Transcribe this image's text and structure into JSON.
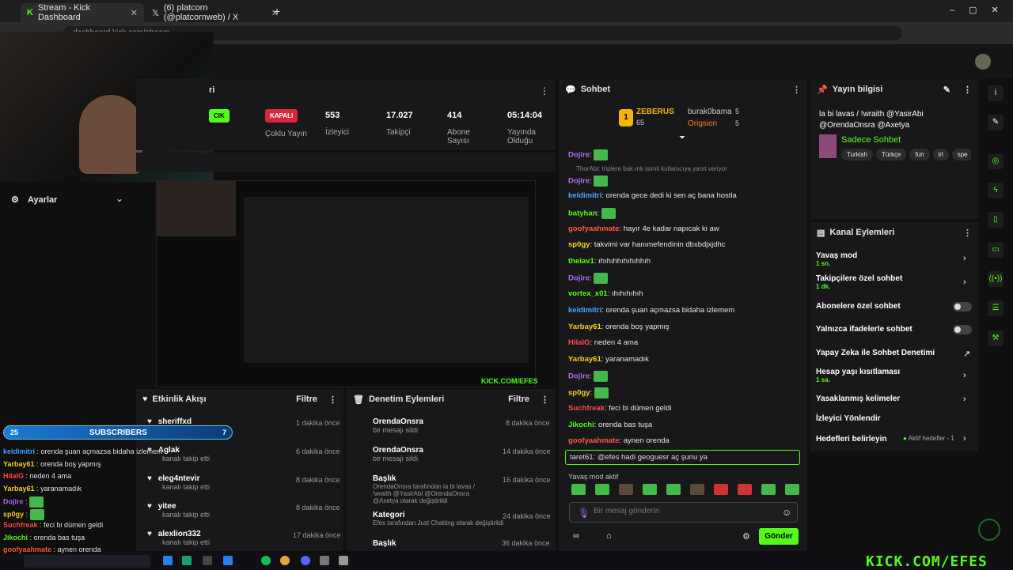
{
  "browser": {
    "tabs": [
      {
        "label": "Stream - Kick Dashboard"
      },
      {
        "label": "(6) platcorn (@platcornweb) / X"
      }
    ],
    "url": "dashboard.kick.com/stream"
  },
  "stream_panel": {
    "title": "ri",
    "badge1": "CIK",
    "badge1_sub": "rtnerlik\nilir",
    "badge2": "KAPALI",
    "badge2_sub": "Çoklu Yayın"
  },
  "stats": [
    {
      "value": "553",
      "label": "İzleyici"
    },
    {
      "value": "17.027",
      "label": "Takipçi"
    },
    {
      "value": "414",
      "label": "Abone Sayısı"
    },
    {
      "value": "05:14:04",
      "label": "Yayında Olduğu"
    }
  ],
  "settings": {
    "label": "Ayarlar"
  },
  "chat": {
    "title": "Sohbet",
    "leaders": [
      {
        "name": "ZEBERUS",
        "score": "65"
      },
      {
        "name": "burak0bama",
        "score": "5"
      },
      {
        "name": "Origsion",
        "score": "5"
      }
    ],
    "lines": [
      {
        "user": "Dojire",
        "text": "",
        "color": "#b06cf5"
      },
      {
        "user": "",
        "text": "ThorAbi: triplere bak mk isimli kullanıcıya yanıt veriyor",
        "color": "#888"
      },
      {
        "user": "Dojire",
        "text": "",
        "color": "#b06cf5"
      },
      {
        "user": "keldimitri",
        "text": "orenda gece dedi ki sen aç bana hostla",
        "color": "#4aa3ff"
      },
      {
        "user": "batyhan",
        "text": "",
        "color": "#53fc18"
      },
      {
        "user": "goofyaahmate",
        "text": "hayır 4e kadar napıcak ki aw",
        "color": "#ff5a3c"
      },
      {
        "user": "sp0gy",
        "text": "takvimi var hanımefendinin dbxbdjxjdhc",
        "color": "#f5d020"
      },
      {
        "user": "theiav1",
        "text": "ıhıhıhhıhıhıhhıh",
        "color": "#53fc18"
      },
      {
        "user": "Dojire",
        "text": "",
        "color": "#b06cf5"
      },
      {
        "user": "vortex_x01",
        "text": "ıhıhıhıhıh",
        "color": "#53fc18"
      },
      {
        "user": "keldimitri",
        "text": "orenda şuan açmazsa bidaha izlemem",
        "color": "#4aa3ff"
      },
      {
        "user": "Yarbay61",
        "text": "orenda boş yapmış",
        "color": "#f5d020"
      },
      {
        "user": "HilalG",
        "text": "neden 4 ama",
        "color": "#ff4a4a"
      },
      {
        "user": "Yarbay61",
        "text": "yaranamadık",
        "color": "#f5d020"
      },
      {
        "user": "Dojire",
        "text": "",
        "color": "#b06cf5"
      },
      {
        "user": "sp0gy",
        "text": "",
        "color": "#f5d020"
      },
      {
        "user": "Suchfreak",
        "text": "feci bi dümen geldi",
        "color": "#ff4a4a"
      },
      {
        "user": "Jikochi",
        "text": "orenda bas tuşa",
        "color": "#53fc18"
      },
      {
        "user": "goofyaahmate",
        "text": "aynen orenda",
        "color": "#ff5a3c"
      }
    ],
    "reply": "taret61: @efes hadi geoguesr aç şunu ya",
    "slow_mode": "Yavaş mod aktif",
    "placeholder": "Bir mesaj gönderin",
    "send": "Gönder"
  },
  "stream_info": {
    "title": "Yayın bilgisi",
    "stream_title": "la bi lavas / !wraith @YasirAbi @OrendaOnsra @Axetya",
    "category": "Sadece Sohbet",
    "tags": [
      "Turkish",
      "Türkçe",
      "fun",
      "irl",
      "spe"
    ]
  },
  "channel_actions": {
    "title": "Kanal Eylemleri",
    "items": [
      {
        "label": "Yavaş mod",
        "sub": "1 sn."
      },
      {
        "label": "Takipçilere özel sohbet",
        "sub": "1 dk."
      },
      {
        "label": "Abonelere özel sohbet",
        "sub": ""
      },
      {
        "label": "Yalnızca ifadelerle sohbet",
        "sub": ""
      },
      {
        "label": "Yapay Zeka ile Sohbet Denetimi",
        "sub": ""
      },
      {
        "label": "Hesap yaşı kısıtlaması",
        "sub": "1 sa."
      },
      {
        "label": "Yasaklanmış kelimeler",
        "sub": ""
      },
      {
        "label": "İzleyici Yönlendir",
        "sub": ""
      },
      {
        "label": "Hedefleri belirleyin",
        "sub": ""
      }
    ],
    "goals_status": "Aktif hedefler - 1"
  },
  "activity": {
    "title": "Etkinlik Akışı",
    "filter": "Filtre",
    "items": [
      {
        "user": "sheriffxd",
        "sub": "",
        "time": "1 dakika önce"
      },
      {
        "user": "Aglak",
        "sub": "kanalı takip etti",
        "time": "6 dakika önce"
      },
      {
        "user": "eleg4ntevir",
        "sub": "kanalı takip etti",
        "time": "8 dakika önce"
      },
      {
        "user": "yitee",
        "sub": "kanalı takip etti",
        "time": "8 dakika önce"
      },
      {
        "user": "alexlion332",
        "sub": "kanalı takip etti",
        "time": "17 dakika önce"
      }
    ]
  },
  "moderation": {
    "title": "Denetim Eylemleri",
    "filter": "Filtre",
    "items": [
      {
        "user": "OrendaOnsra",
        "sub": "bir mesajı sildi",
        "time": "8 dakika önce"
      },
      {
        "user": "OrendaOnsra",
        "sub": "bir mesajı sildi",
        "time": "14 dakika önce"
      },
      {
        "user": "Başlık",
        "sub": "OrendaOnsra tarafından la bi lavas / !wraith @YasirAbi @OrendaOnsra @Axetya olarak değiştirildi",
        "time": "16 dakika önce"
      },
      {
        "user": "Kategori",
        "sub": "Efes tarafından Just Chatting olarak değiştirildi",
        "time": "24 dakika önce"
      },
      {
        "user": "Başlık",
        "sub": "",
        "time": "36 dakika önce"
      }
    ]
  },
  "overlay": {
    "subs_count": "25",
    "subs_label": "SUBSCRIBERS",
    "subs_goal": "7",
    "watermark": "KICK.COM/EFES",
    "chat": [
      {
        "user": "keldimitri",
        "text": "orenda şuan açmazsa bidaha izlemem",
        "color": "#4aa3ff"
      },
      {
        "user": "Yarbay61",
        "text": "orenda boş yapmış",
        "color": "#f5d020"
      },
      {
        "user": "HilalG",
        "text": "neden 4 ama",
        "color": "#ff4a4a"
      },
      {
        "user": "Yarbay61",
        "text": "yaranamadık",
        "color": "#f5d020"
      },
      {
        "user": "Dojire",
        "text": "",
        "color": "#b06cf5"
      },
      {
        "user": "sp0gy",
        "text": "",
        "color": "#f5d020"
      },
      {
        "user": "Suchfreak",
        "text": "feci bi dümen geldi",
        "color": "#ff4a4a"
      },
      {
        "user": "Jikochi",
        "text": "orenda bas tuşa",
        "color": "#53fc18"
      },
      {
        "user": "goofyaahmate",
        "text": "aynen orenda",
        "color": "#ff5a3c"
      }
    ]
  }
}
